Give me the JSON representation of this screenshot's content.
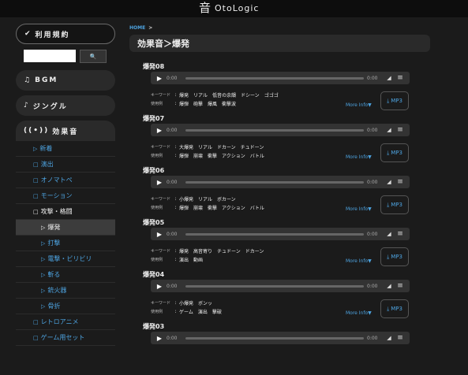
{
  "header": {
    "logo_mark": "音",
    "logo_text": "OtoLogic"
  },
  "sidebar": {
    "terms_label": "利用規約",
    "search_button": "🔍",
    "bgm_label": "BGM",
    "jingle_label": "ジングル",
    "sfx_label": "効果音",
    "sub_items": [
      {
        "icon": "▷",
        "label": "新着"
      },
      {
        "icon": "□",
        "label": "演出"
      },
      {
        "icon": "□",
        "label": "オノマトペ"
      },
      {
        "icon": "□",
        "label": "モーション"
      },
      {
        "icon": "□",
        "label": "攻撃・格闘"
      },
      {
        "icon": "▷",
        "label": "爆発"
      },
      {
        "icon": "▷",
        "label": "打撃"
      },
      {
        "icon": "▷",
        "label": "電撃・ビリビリ"
      },
      {
        "icon": "▷",
        "label": "斬る"
      },
      {
        "icon": "▷",
        "label": "銃火器"
      },
      {
        "icon": "▷",
        "label": "骨折"
      },
      {
        "icon": "□",
        "label": "レトロアニメ"
      },
      {
        "icon": "□",
        "label": "ゲーム用セット"
      }
    ]
  },
  "breadcrumb": {
    "home": "HOME",
    "sep": ">"
  },
  "page_title": "効果音＞爆発",
  "labels": {
    "keyword": "キーワード",
    "usage": "使用例",
    "colon": ":",
    "more": "More Info▼",
    "mp3": "MP3",
    "time": "0:00"
  },
  "tracks": [
    {
      "title": "爆発08",
      "keywords": [
        "爆発",
        "リアル",
        "低音の余韻",
        "ドシーン",
        "ゴゴゴ"
      ],
      "usage": [
        "爆弾",
        "砲撃",
        "爆風",
        "衝撃波"
      ]
    },
    {
      "title": "爆発07",
      "keywords": [
        "大爆発",
        "リアル",
        "ドカーン",
        "チュドーン"
      ],
      "usage": [
        "爆弾",
        "崩壊",
        "衝撃",
        "アクション",
        "バトル"
      ]
    },
    {
      "title": "爆発06",
      "keywords": [
        "小爆発",
        "リアル",
        "ボカーン"
      ],
      "usage": [
        "爆弾",
        "崩壊",
        "衝撃",
        "アクション",
        "バトル"
      ]
    },
    {
      "title": "爆発05",
      "keywords": [
        "爆発",
        "高音寄り",
        "チュドーン",
        "ドカーン"
      ],
      "usage": [
        "演出",
        "動画"
      ]
    },
    {
      "title": "爆発04",
      "keywords": [
        "小爆発",
        "ボンッ"
      ],
      "usage": [
        "ゲーム",
        "演出",
        "撃破"
      ]
    },
    {
      "title": "爆発03",
      "keywords": [],
      "usage": []
    }
  ]
}
